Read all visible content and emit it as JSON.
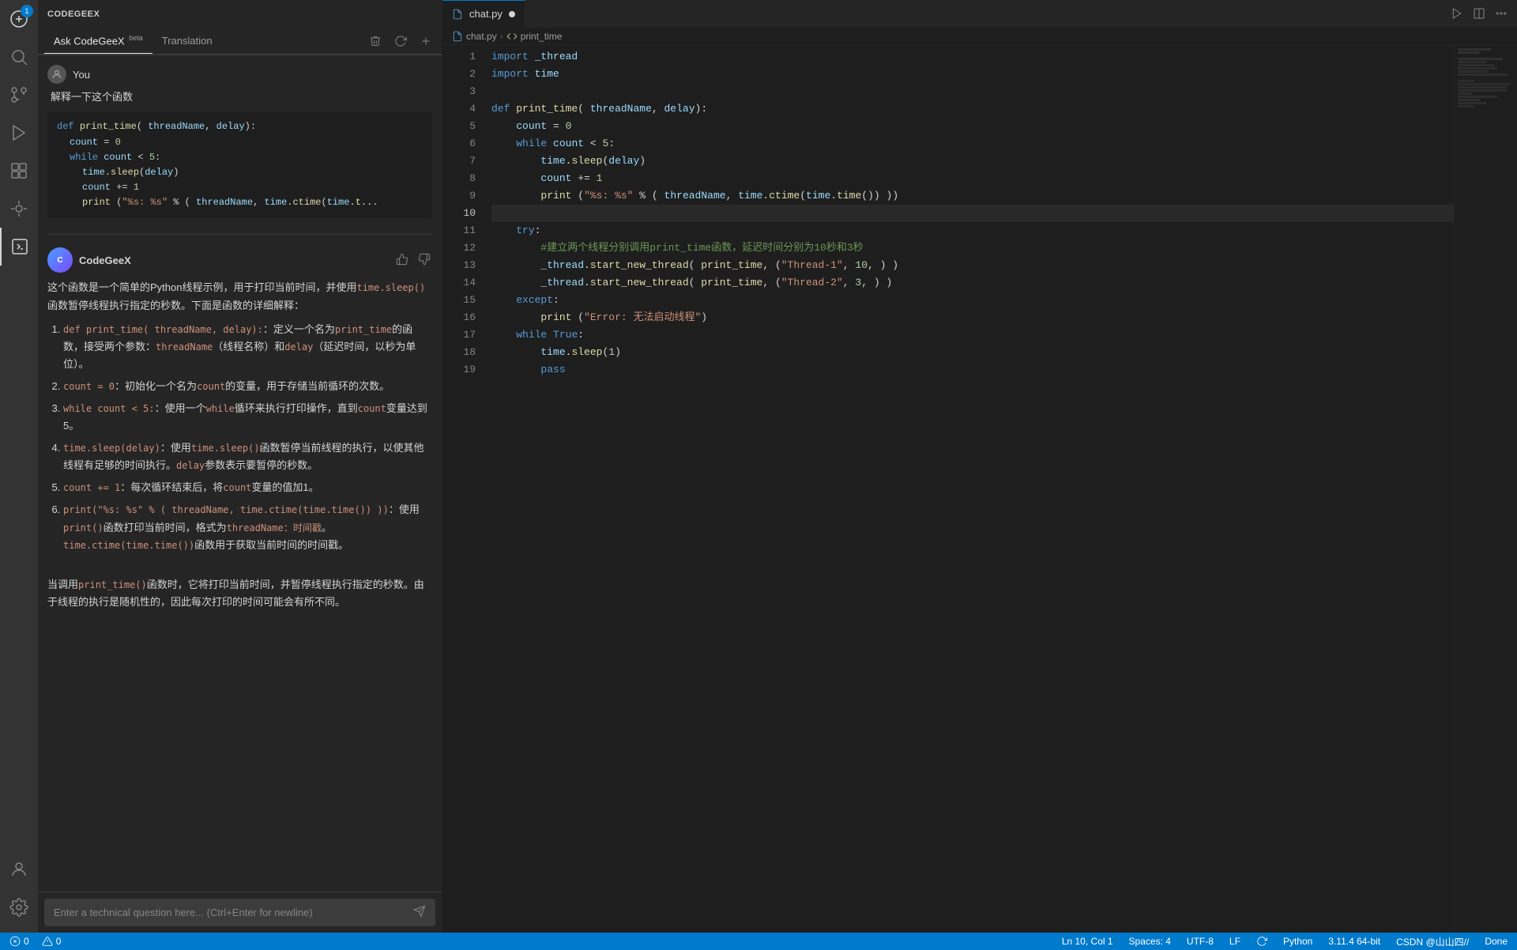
{
  "app": {
    "title": "CODEGEEX"
  },
  "left_panel": {
    "title": "CODEGEEX",
    "tabs": [
      {
        "label": "Ask CodeGeeX",
        "badge": "beta",
        "active": true
      },
      {
        "label": "Translation",
        "active": false
      }
    ],
    "actions": {
      "delete": "delete",
      "refresh": "refresh",
      "add": "add"
    },
    "user_label": "You",
    "user_question": "解释一下这个函数",
    "code_snippet": [
      "def print_time( threadName, delay):",
      "    count = 0",
      "    while count < 5:",
      "        time.sleep(delay)",
      "        count += 1",
      "        print (\"%s: %s\" % ( threadName, time.ctime(time.t..."
    ],
    "ai_name": "CodeGeeX",
    "ai_response": {
      "intro": "这个函数是一个简单的Python线程示例，用于打印当前时间，并使用time.sleep()函数暂停线程执行指定的秒数。下面是函数的详细解释：",
      "points": [
        {
          "label": "def print_time( threadName, delay):",
          "text": "定义一个名为print_time的函数，接受两个参数：threadName（线程名称）和delay（延迟时间，以秒为单位）。"
        },
        {
          "label": "count = 0:",
          "text": "初始化一个名为count的变量，用于存储当前循环的次数。"
        },
        {
          "label": "while count < 5::",
          "text": "使用一个while循环来执行打印操作，直到count变量达到5。"
        },
        {
          "label": "time.sleep(delay):",
          "text": "使用time.sleep()函数暂停当前线程的执行，以使其他线程有足够的时间执行。delay参数表示要暂停的秒数。"
        },
        {
          "label": "count += 1:",
          "text": "每次循环结束后，将count变量的值加1。"
        },
        {
          "label": "print(\"%s: %s\" % ( threadName, time.ctime(time.time()) )):",
          "text": "使用print()函数打印当前时间，格式为threadName：时间戳。time.ctime(time.time())函数用于获取当前时间的时间戳。"
        }
      ],
      "conclusion": "当调用print_time()函数时，它将打印当前时间，并暂停线程执行指定的秒数。由于线程的执行是随机性的，因此每次打印的时间可能会有所不同。"
    }
  },
  "editor": {
    "tab_label": "chat.py",
    "tab_modified": true,
    "breadcrumb": {
      "file": "chat.py",
      "symbol": "print_time"
    },
    "code_lines": [
      {
        "num": 1,
        "content": "import _thread"
      },
      {
        "num": 2,
        "content": "import time"
      },
      {
        "num": 3,
        "content": ""
      },
      {
        "num": 4,
        "content": "def print_time( threadName, delay):"
      },
      {
        "num": 5,
        "content": "    count = 0"
      },
      {
        "num": 6,
        "content": "    while count < 5:"
      },
      {
        "num": 7,
        "content": "        time.sleep(delay)"
      },
      {
        "num": 8,
        "content": "        count += 1"
      },
      {
        "num": 9,
        "content": "        print (\"%s: %s\" % ( threadName, time.ctime(time.time()) ))"
      },
      {
        "num": 10,
        "content": ""
      },
      {
        "num": 11,
        "content": "    try:"
      },
      {
        "num": 12,
        "content": "        #建立两个线程分别调用print_time函数，延迟时间分别为10秒和3秒"
      },
      {
        "num": 13,
        "content": "        _thread.start_new_thread( print_time, (\"Thread-1\", 10, ) )"
      },
      {
        "num": 14,
        "content": "        _thread.start_new_thread( print_time, (\"Thread-2\", 3, ) )"
      },
      {
        "num": 15,
        "content": "    except:"
      },
      {
        "num": 16,
        "content": "        print (\"Error: 无法启动线程\")"
      },
      {
        "num": 17,
        "content": "    while True:"
      },
      {
        "num": 18,
        "content": "        time.sleep(1)"
      },
      {
        "num": 19,
        "content": "        pass"
      }
    ]
  },
  "status_bar": {
    "errors": "0",
    "warnings": "0",
    "line_col": "Ln 10, Col 1",
    "spaces": "Spaces: 4",
    "encoding": "UTF-8",
    "line_ending": "LF",
    "language": "Python",
    "version": "3.11.4 64-bit",
    "csdn": "CSDN @山山四//",
    "done": "Done"
  },
  "input_placeholder": "Enter a technical question here... (Ctrl+Enter for newline)"
}
